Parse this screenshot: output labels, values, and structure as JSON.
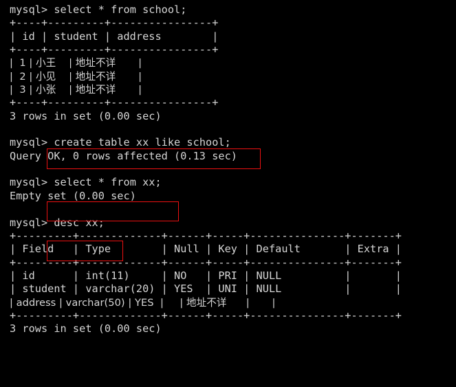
{
  "terminal": {
    "app": "mysql-client-terminal",
    "background_color": "#000000",
    "text_color": "#d6d6d6",
    "highlight_color": "#ee1111",
    "prompt": "mysql>",
    "lines": [
      "mysql> select * from school;",
      "+----+---------+----------------+",
      "| id | student | address        |",
      "+----+---------+----------------+",
      "|  1 | 小王    | 地址不详       |",
      "|  2 | 小见    | 地址不详       |",
      "|  3 | 小张    | 地址不详       |",
      "+----+---------+----------------+",
      "3 rows in set (0.00 sec)",
      "",
      "mysql> create table xx like school;",
      "Query OK, 0 rows affected (0.13 sec)",
      "",
      "mysql> select * from xx;",
      "Empty set (0.00 sec)",
      "",
      "mysql> desc xx;",
      "+---------+-------------+------+-----+---------------+-------+",
      "| Field   | Type        | Null | Key | Default       | Extra |",
      "+---------+-------------+------+-----+---------------+-------+",
      "| id      | int(11)     | NO   | PRI | NULL          |       |",
      "| student | varchar(20) | YES  | UNI | NULL          |       |",
      "| address | varchar(50) | YES  |     | 地址不详      |       |",
      "+---------+-------------+------+-----+---------------+-------+",
      "3 rows in set (0.00 sec)"
    ]
  },
  "commands": {
    "select_school": {
      "prompt": "mysql>",
      "text": " select * from school;",
      "highlighted": false
    },
    "create_table": {
      "prompt": "mysql>",
      "text": " create table xx like school;",
      "highlighted": true
    },
    "select_xx": {
      "prompt": "mysql>",
      "text": " select * from xx;",
      "highlighted": true
    },
    "desc_xx": {
      "prompt": "mysql>",
      "text": " desc xx;",
      "highlighted": true
    }
  },
  "results": {
    "school_rows_status": "3 rows in set (0.00 sec)",
    "create_status": "Query OK, 0 rows affected (0.13 sec)",
    "select_xx_status": "Empty set (0.00 sec)",
    "desc_rows_status": "3 rows in set (0.00 sec)"
  },
  "school_table": {
    "border": "+----+---------+----------------+",
    "header": "| id | student | address        |",
    "columns": [
      "id",
      "student",
      "address"
    ],
    "rows": [
      {
        "line": "|  1 | 小王    | 地址不详       |",
        "id": "1",
        "student": "小王",
        "address": "地址不详"
      },
      {
        "line": "|  2 | 小见    | 地址不详       |",
        "id": "2",
        "student": "小见",
        "address": "地址不详"
      },
      {
        "line": "|  3 | 小张    | 地址不详       |",
        "id": "3",
        "student": "小张",
        "address": "地址不详"
      }
    ]
  },
  "desc_table": {
    "border": "+---------+-------------+------+-----+---------------+-------+",
    "header": "| Field   | Type        | Null | Key | Default       | Extra |",
    "columns": [
      "Field",
      "Type",
      "Null",
      "Key",
      "Default",
      "Extra"
    ],
    "rows": [
      {
        "line": "| id      | int(11)     | NO   | PRI | NULL          |       |",
        "field": "id",
        "type": "int(11)",
        "null": "NO",
        "key": "PRI",
        "default": "NULL",
        "extra": ""
      },
      {
        "line": "| student | varchar(20) | YES  | UNI | NULL          |       |",
        "field": "student",
        "type": "varchar(20)",
        "null": "YES",
        "key": "UNI",
        "default": "NULL",
        "extra": ""
      },
      {
        "line": "| address | varchar(50) | YES  |     | 地址不详      |       |",
        "field": "address",
        "type": "varchar(50)",
        "null": "YES",
        "key": "",
        "default": "地址不详",
        "extra": ""
      }
    ]
  }
}
